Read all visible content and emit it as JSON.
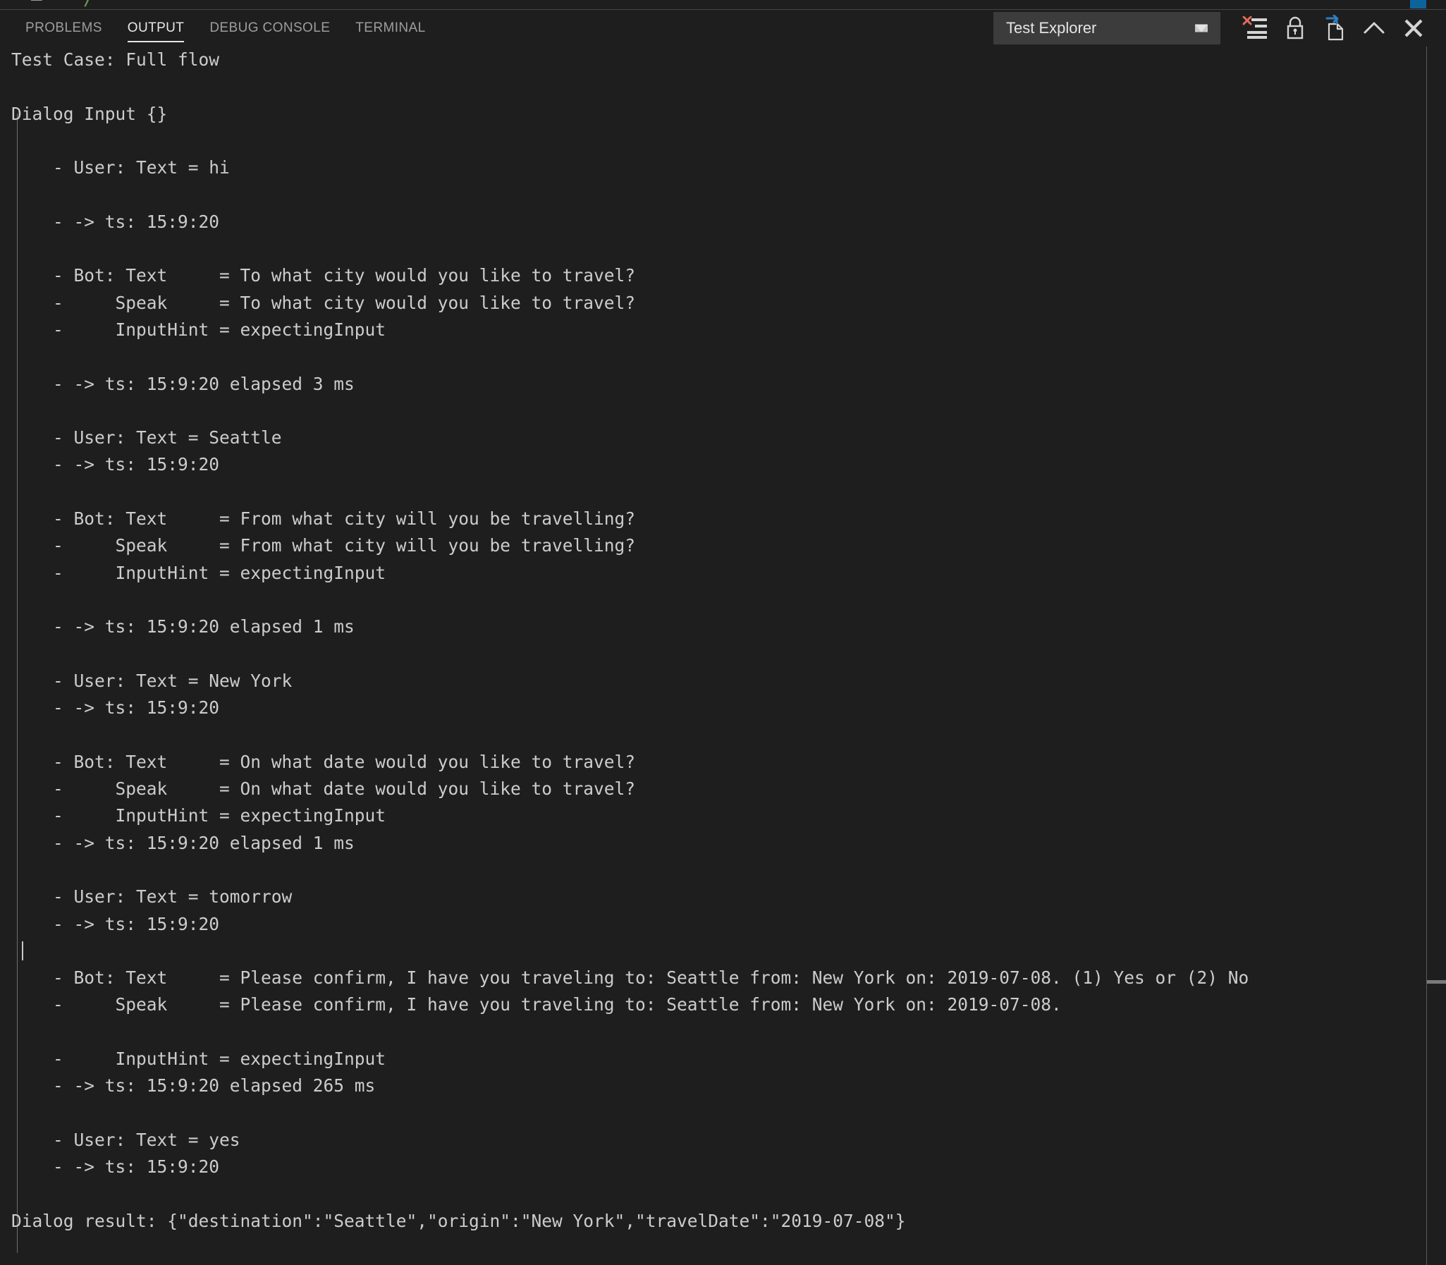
{
  "window": {
    "editor_sliver": {
      "gray_fragment": "—",
      "green_fragment": "/"
    },
    "tab_accent_color": "#0e639c"
  },
  "panel": {
    "tabs": [
      {
        "label": "PROBLEMS",
        "active": false
      },
      {
        "label": "OUTPUT",
        "active": true
      },
      {
        "label": "DEBUG CONSOLE",
        "active": false
      },
      {
        "label": "TERMINAL",
        "active": false
      }
    ],
    "channel_select": {
      "value": "Test Explorer",
      "caret_icon": "chevron-down-icon"
    },
    "actions": [
      {
        "name": "clear-output-button",
        "icon": "clear-output-icon",
        "title": "Clear Output"
      },
      {
        "name": "lock-scroll-button",
        "icon": "lock-icon",
        "title": "Turn Auto Scrolling Off"
      },
      {
        "name": "open-in-editor-button",
        "icon": "open-in-editor-icon",
        "title": "Open Output in Editor"
      },
      {
        "name": "maximize-panel-button",
        "icon": "chevron-up-icon",
        "title": "Maximize Panel Size"
      },
      {
        "name": "close-panel-button",
        "icon": "close-icon",
        "title": "Close Panel"
      }
    ]
  },
  "colors": {
    "background": "#1e1e1e",
    "foreground": "#cccccc",
    "tab_active": "#e7e7e7",
    "tab_inactive": "#9d9d9d",
    "select_background": "#3c3c3c",
    "clear_icon_accent": "#e06c5a",
    "open_editor_accent": "#2d7fc1",
    "indent_guide": "#707070",
    "ruler_border": "#5a5a5a"
  },
  "output": {
    "lines": [
      "Test Case: Full flow",
      "",
      "Dialog Input {}",
      "",
      "    - User: Text = hi",
      "",
      "    - -> ts: 15:9:20",
      "",
      "    - Bot: Text     = To what city would you like to travel?",
      "    -     Speak     = To what city would you like to travel?",
      "    -     InputHint = expectingInput",
      "",
      "    - -> ts: 15:9:20 elapsed 3 ms",
      "",
      "    - User: Text = Seattle",
      "    - -> ts: 15:9:20",
      "",
      "    - Bot: Text     = From what city will you be travelling?",
      "    -     Speak     = From what city will you be travelling?",
      "    -     InputHint = expectingInput",
      "",
      "    - -> ts: 15:9:20 elapsed 1 ms",
      "",
      "    - User: Text = New York",
      "    - -> ts: 15:9:20",
      "",
      "    - Bot: Text     = On what date would you like to travel?",
      "    -     Speak     = On what date would you like to travel?",
      "    -     InputHint = expectingInput",
      "    - -> ts: 15:9:20 elapsed 1 ms",
      "",
      "    - User: Text = tomorrow",
      "    - -> ts: 15:9:20",
      "",
      "    - Bot: Text     = Please confirm, I have you traveling to: Seattle from: New York on: 2019-07-08. (1) Yes or (2) No",
      "    -     Speak     = Please confirm, I have you traveling to: Seattle from: New York on: 2019-07-08.",
      "",
      "    -     InputHint = expectingInput",
      "    - -> ts: 15:9:20 elapsed 265 ms",
      "",
      "    - User: Text = yes",
      "    - -> ts: 15:9:20",
      "",
      "Dialog result: {\"destination\":\"Seattle\",\"origin\":\"New York\",\"travelDate\":\"2019-07-08\"}"
    ],
    "caret_on_line_index": 33
  }
}
